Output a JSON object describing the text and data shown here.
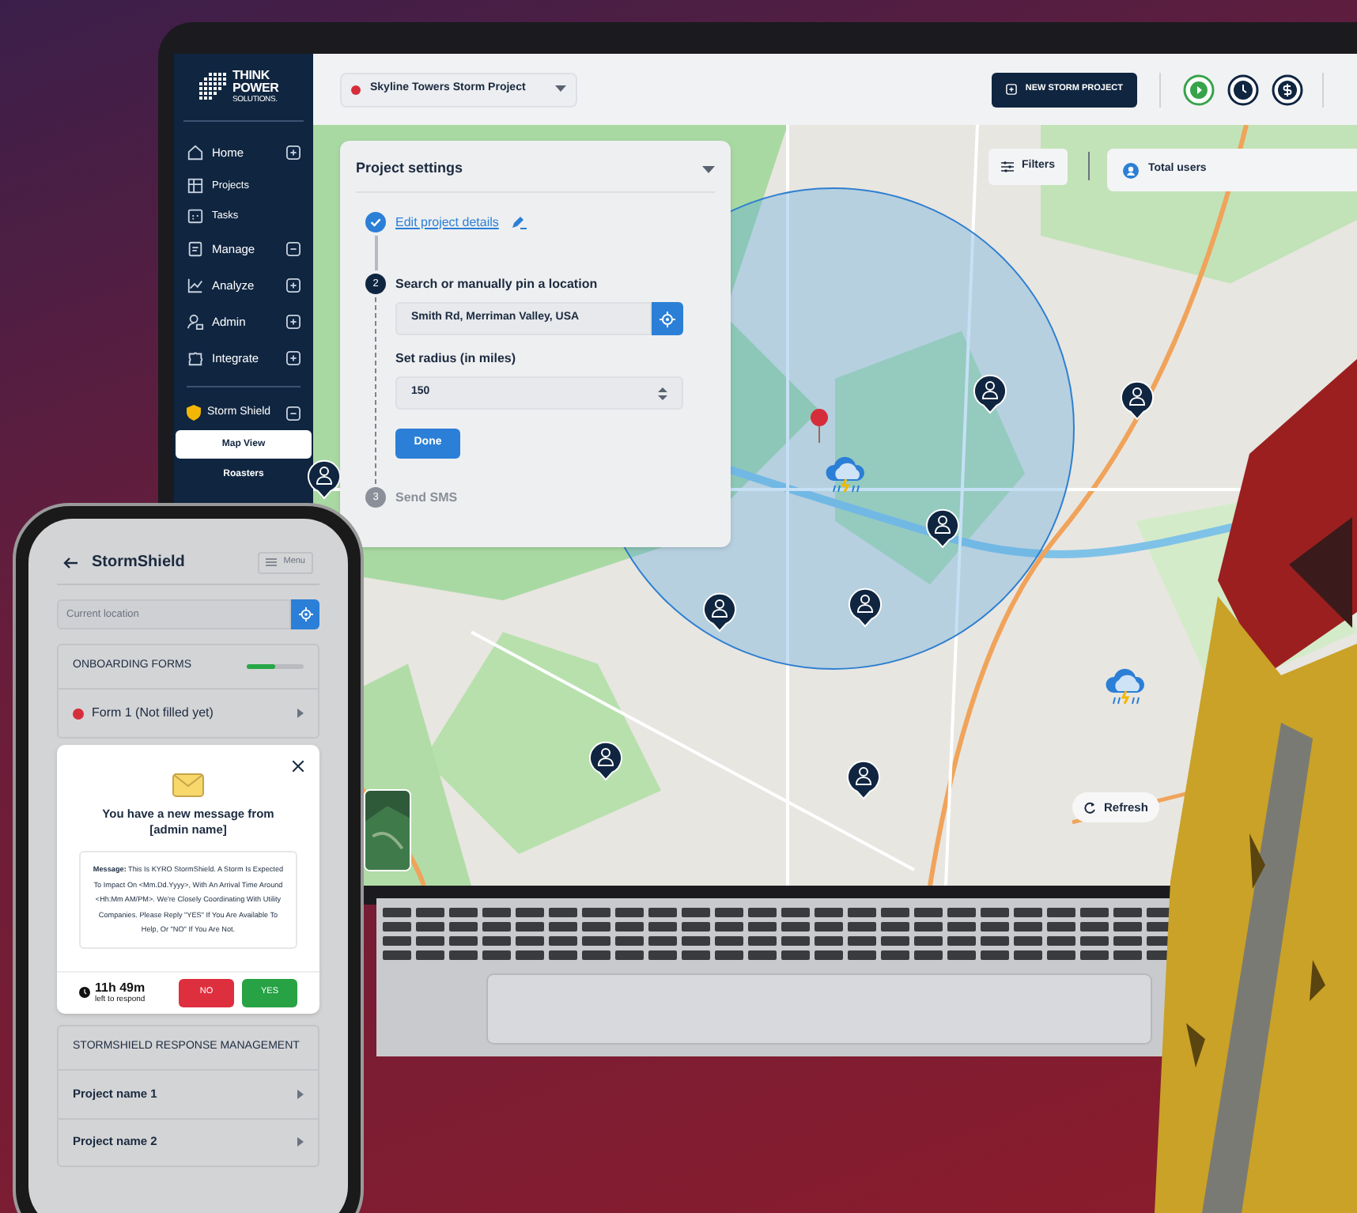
{
  "laptop": {
    "logo": {
      "lines": [
        "THINK",
        "POWER",
        "SOLUTIONS."
      ]
    },
    "sidebar": {
      "items": [
        {
          "label": "Home",
          "kind": "group",
          "expanded": false
        },
        {
          "label": "Projects",
          "kind": "link"
        },
        {
          "label": "Tasks",
          "kind": "link"
        },
        {
          "label": "Manage",
          "kind": "group",
          "expanded": true
        },
        {
          "label": "Analyze",
          "kind": "group",
          "expanded": false
        },
        {
          "label": "Admin",
          "kind": "group",
          "expanded": false
        },
        {
          "label": "Integrate",
          "kind": "group",
          "expanded": false
        }
      ],
      "section": {
        "label": "Storm Shield",
        "expanded": true,
        "children": [
          {
            "label": "Map View",
            "selected": true
          },
          {
            "label": "Roasters",
            "selected": false
          }
        ]
      }
    },
    "top_bar": {
      "project_selector": "Skyline Towers Storm Project",
      "new_button": "NEW STORM PROJECT"
    },
    "project_settings": {
      "title": "Project settings",
      "steps": [
        {
          "kind": "done",
          "label": "Edit project details"
        },
        {
          "number": "2",
          "kind": "active",
          "label": "Search or manually pin a location",
          "location": "Smith Rd, Merriman Valley, USA",
          "radius_label": "Set radius (in miles)",
          "radius": "150",
          "done_button": "Done"
        },
        {
          "number": "3",
          "kind": "pending",
          "label": "Send SMS"
        }
      ]
    },
    "filters_button": "Filters",
    "total_users": "Total users",
    "refresh_button": "Refresh"
  },
  "phone": {
    "title": "StormShield",
    "menu_button": "Menu",
    "location_placeholder": "Current location",
    "onboarding": {
      "title": "ONBOARDING FORMS",
      "level": 0.5,
      "forms": [
        {
          "label": "Form 1 (Not filled yet)"
        }
      ]
    },
    "message": {
      "title": "You have a new message from [admin name]",
      "body": "**Message:** This Is KYRO StormShield. A Storm Is Expected To Impact On <Mm.Dd.Yyyy>, With An Arrival Time Around <Hh:Mm AM/PM>. We're Closely Coordinating With Utility Companies. Please  Reply \"YES\" If You Are Available To Help, Or \"NO\" If You Are Not.",
      "timer": "11h 49m",
      "timer_caption": "left to respond",
      "no_button": "NO",
      "yes_button": "YES"
    },
    "response": {
      "title": "STORMSHIELD RESPONSE MANAGEMENT",
      "projects": [
        "Project name 1",
        "Project name 2"
      ]
    }
  }
}
